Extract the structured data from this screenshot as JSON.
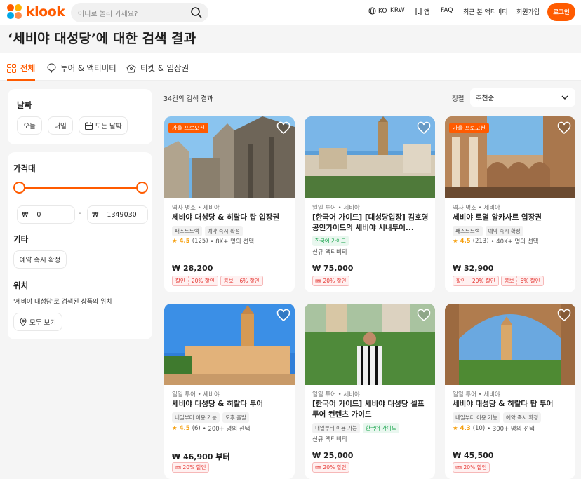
{
  "header": {
    "logo_text": "klook",
    "search_placeholder": "어디로 놀러 가세요?",
    "lang": "KO",
    "currency": "KRW",
    "app": "앱",
    "faq": "FAQ",
    "recent": "최근 본 액티비티",
    "signup": "회원가입",
    "login": "로그인"
  },
  "page_title": "‘세비야 대성당’에 대한 검색 결과",
  "tabs": [
    {
      "label": "전체",
      "icon": "grid-icon"
    },
    {
      "label": "투어 & 액티비티",
      "icon": "balloon-icon"
    },
    {
      "label": "티켓 & 입장권",
      "icon": "ticket-icon"
    }
  ],
  "filters": {
    "date": {
      "title": "날짜",
      "chips": [
        "오늘",
        "내일",
        "모든 날짜"
      ]
    },
    "price": {
      "title": "가격대",
      "currency": "₩",
      "min": "0",
      "max": "1349030",
      "sep": "-"
    },
    "other": {
      "title": "기타",
      "chip": "예약 즉시 확정"
    },
    "location": {
      "title": "위치",
      "desc": "'세비야 대성당'로 검색된 상품의 위치",
      "button": "모두 보기"
    }
  },
  "results": {
    "count_text": "34건의 검색 결과",
    "sort_label": "정렬",
    "sort_value": "추천순"
  },
  "cards": [
    {
      "badge": "가을 프로모션",
      "category": "역사 명소 • 세비야",
      "title": "세비야 대성당 & 히랄다 탑 입장권",
      "tags": [
        "패스트트랙",
        "예약 즉시 확정"
      ],
      "rating": "4.5",
      "reviews": "(125)",
      "booked": "• 8K+ 명의 선택",
      "price": "₩ 28,200",
      "promo_a": [
        "할인",
        "20% 할인"
      ],
      "promo_b": [
        "콤보",
        "6% 할인"
      ]
    },
    {
      "badge": "",
      "category": "일일 투어 • 세비야",
      "title": "[한국어 가이드] [대성당입장] 김호영 공인가이드의 세비야 시내투어...",
      "tags_green": "한국어 가이드",
      "new": "신규 액티비티",
      "price": "₩ 75,000",
      "coupon": "20% 할인"
    },
    {
      "badge": "가을 프로모션",
      "category": "역사 명소 • 세비야",
      "title": "세비야 로열 알카사르 입장권",
      "tags": [
        "패스트트랙",
        "예약 즉시 확정"
      ],
      "rating": "4.5",
      "reviews": "(213)",
      "booked": "• 40K+ 명의 선택",
      "price": "₩ 32,900",
      "promo_a": [
        "할인",
        "20% 할인"
      ],
      "promo_b": [
        "콤보",
        "6% 할인"
      ]
    },
    {
      "badge": "",
      "category": "일일 투어 • 세비야",
      "title": "세비야 대성당 & 히랄다 투어",
      "tags": [
        "내일부터 이용 가능",
        "오후 출발"
      ],
      "rating": "4.5",
      "reviews": "(6)",
      "booked": "• 200+ 명의 선택",
      "price": "₩ 46,900 부터",
      "coupon": "20% 할인"
    },
    {
      "badge": "",
      "category": "일일 투어 • 세비야",
      "title": "[한국어 가이드] 세비야 대성당 셀프 투어 컨텐츠 가이드",
      "tags": [
        "내일부터 이용 가능"
      ],
      "tags_green": "한국어 가이드",
      "new": "신규 액티비티",
      "price": "₩ 25,000",
      "coupon": "20% 할인"
    },
    {
      "badge": "",
      "category": "일일 투어 • 세비야",
      "title": "세비야 대성당 & 히랄다 탑 투어",
      "tags": [
        "내일부터 이용 가능",
        "예약 즉시 확정"
      ],
      "rating": "4.3",
      "reviews": "(10)",
      "booked": "• 300+ 명의 선택",
      "price": "₩ 45,500",
      "coupon": "20% 할인"
    }
  ],
  "colors": {
    "brand": "#ff5b00",
    "promo_red": "#e53935",
    "star": "#f59e0b",
    "green": "#16a34a"
  }
}
